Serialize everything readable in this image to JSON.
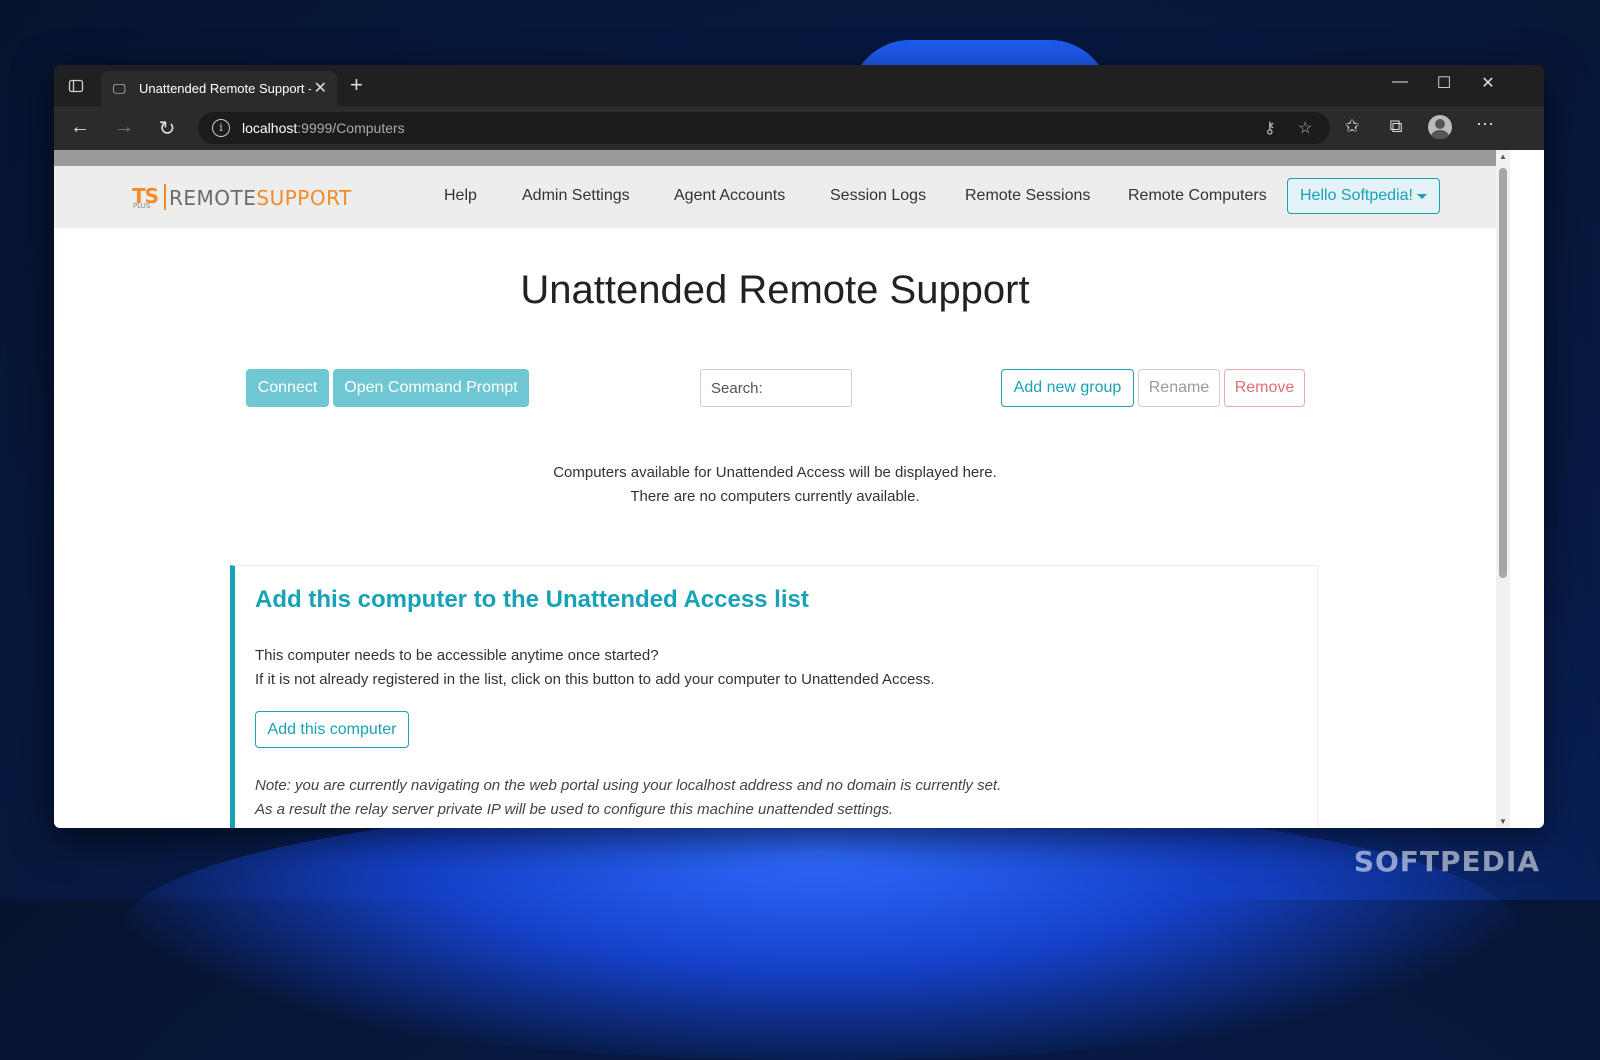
{
  "browser": {
    "tab_title": "Unattended Remote Support - TSplus Remote Support",
    "new_tab_icon": "+",
    "close_icon": "✕",
    "url_host": "localhost",
    "url_rest": ":9999/Computers"
  },
  "navbar": {
    "logo_ts": "TS",
    "logo_plus": "PLUS",
    "logo_remote": "REMOTE",
    "logo_support": "SUPPORT",
    "links": [
      "Help",
      "Admin Settings",
      "Agent Accounts",
      "Session Logs",
      "Remote Sessions",
      "Remote Computers"
    ],
    "user_menu": "Hello Softpedia!"
  },
  "page": {
    "title": "Unattended Remote Support",
    "connect": "Connect",
    "open_cmd": "Open Command Prompt",
    "search_placeholder": "Search:",
    "add_group": "Add new group",
    "rename": "Rename",
    "remove": "Remove",
    "empty_line1": "Computers available for Unattended Access will be displayed here.",
    "empty_line2": "There are no computers currently available."
  },
  "card": {
    "title": "Add this computer to the Unattended Access list",
    "line1": "This computer needs to be accessible anytime once started?",
    "line2": "If it is not already registered in the list, click on this button to add your computer to Unattended Access.",
    "button": "Add this computer",
    "note1": "Note: you are currently navigating on the web portal using your localhost address and no domain is currently set.",
    "note2": "As a result the relay server private IP will be used to configure this machine unattended settings."
  },
  "watermark": "SOFTPEDIA",
  "colors": {
    "accent": "#17a2b8",
    "logo_orange": "#f28c28",
    "danger": "#e46b76"
  }
}
